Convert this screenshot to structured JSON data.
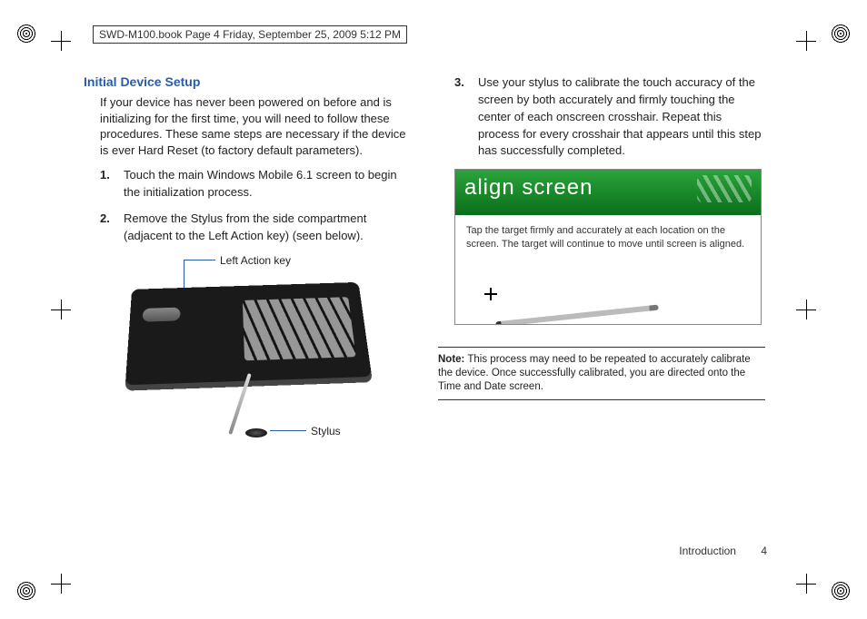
{
  "crop_header": "SWD-M100.book  Page 4  Friday, September 25, 2009  5:12 PM",
  "section_title": "Initial Device Setup",
  "intro": "If your device has never been powered on before and is initializing for the first time, you will need to follow these procedures. These same steps are necessary if the device is ever Hard Reset (to factory default parameters).",
  "steps_left": [
    {
      "num": "1.",
      "text": "Touch the main Windows Mobile 6.1 screen to begin the initialization process."
    },
    {
      "num": "2.",
      "text": "Remove the Stylus from the side compartment (adjacent to the Left Action key) (seen below)."
    }
  ],
  "labels": {
    "left_action": "Left Action key",
    "stylus": "Stylus"
  },
  "steps_right": [
    {
      "num": "3.",
      "text": "Use your stylus to calibrate the touch accuracy of the screen by both accurately and firmly touching the center of each onscreen crosshair. Repeat this process for every crosshair that appears until this step has successfully completed."
    }
  ],
  "screenshot": {
    "title": "align screen",
    "body": "Tap the target firmly and accurately at each location on the screen. The target will continue to move until screen is aligned."
  },
  "note_label": "Note:",
  "note_text": " This process may need to be repeated to accurately calibrate the device. Once successfully calibrated, you are directed onto the Time and Date screen.",
  "footer_section": "Introduction",
  "footer_page": "4"
}
